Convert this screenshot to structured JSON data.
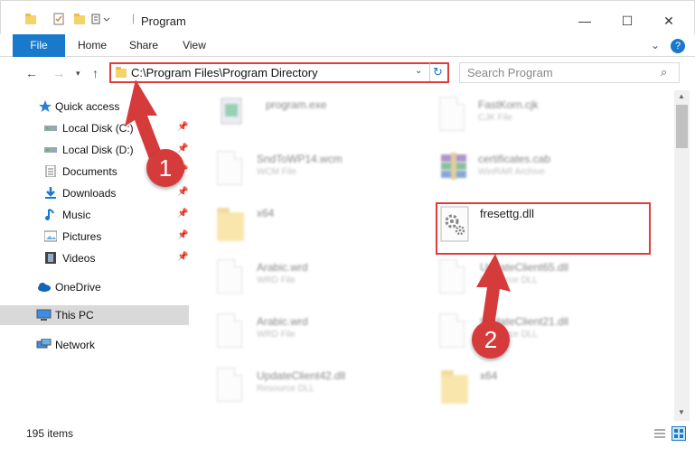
{
  "window": {
    "title": "Program",
    "minimize": "—",
    "maximize": "☐",
    "close": "✕"
  },
  "ribbon": {
    "tabs": [
      "File",
      "Home",
      "Share",
      "View"
    ],
    "help": "?",
    "expand": "⌄"
  },
  "address": {
    "path": "C:\\Program Files\\Program Directory",
    "search_placeholder": "Search Program"
  },
  "sidebar": {
    "items": [
      {
        "label": "Quick access",
        "icon": "star-icon"
      },
      {
        "label": "Local Disk (C:)",
        "icon": "drive-icon",
        "pinned": true
      },
      {
        "label": "Local Disk (D:)",
        "icon": "drive-icon",
        "pinned": true
      },
      {
        "label": "Documents",
        "icon": "documents-icon",
        "pinned": true
      },
      {
        "label": "Downloads",
        "icon": "download-icon",
        "pinned": true
      },
      {
        "label": "Music",
        "icon": "music-icon",
        "pinned": true
      },
      {
        "label": "Pictures",
        "icon": "pictures-icon",
        "pinned": true
      },
      {
        "label": "Videos",
        "icon": "videos-icon",
        "pinned": true
      },
      {
        "label": "OneDrive",
        "icon": "cloud-icon"
      },
      {
        "label": "This PC",
        "icon": "computer-icon",
        "selected": true
      },
      {
        "label": "Network",
        "icon": "network-icon"
      }
    ]
  },
  "files": {
    "program_exe": {
      "name": "program.exe"
    },
    "fastkorn": {
      "name": "FastKorn.cjk",
      "type": "CJK File"
    },
    "sndtowp": {
      "name": "SndToWP14.wcm",
      "type": "WCM File"
    },
    "certificates": {
      "name": "certificates.cab",
      "type": "WinRAR Archive"
    },
    "x64_a": {
      "name": "x64"
    },
    "fresettg": {
      "name": "fresettg.dll"
    },
    "arabic_1": {
      "name": "Arabic.wrd",
      "type": "WRD File"
    },
    "updateclient65": {
      "name": "UpdateClient65.dll",
      "type": "Resource DLL"
    },
    "arabic_2": {
      "name": "Arabic.wrd",
      "type": "WRD File"
    },
    "updateclient21": {
      "name": "UpdateClient21.dll",
      "type": "Resource DLL"
    },
    "updateclient42": {
      "name": "UpdateClient42.dll",
      "type": "Resource DLL"
    },
    "x64_b": {
      "name": "x64"
    }
  },
  "status": {
    "item_count": "195 items"
  },
  "annotations": {
    "marker1": "1",
    "marker2": "2"
  },
  "colors": {
    "accent": "#1979ca",
    "highlight": "#e03c3c",
    "marker": "#d63b3b"
  }
}
